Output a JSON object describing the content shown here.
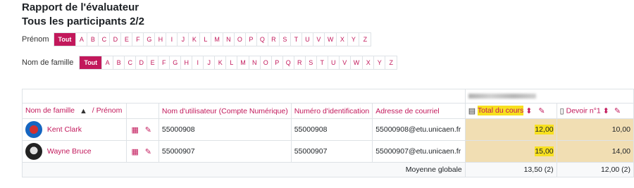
{
  "page": {
    "title": "Rapport de l'évaluateur",
    "subtitle": "Tous les participants 2/2"
  },
  "filters": {
    "firstname_label": "Prénom",
    "lastname_label": "Nom de famille",
    "all_label": "Tout",
    "letters": [
      "A",
      "B",
      "C",
      "D",
      "E",
      "F",
      "G",
      "H",
      "I",
      "J",
      "K",
      "L",
      "M",
      "N",
      "O",
      "P",
      "Q",
      "R",
      "S",
      "T",
      "U",
      "V",
      "W",
      "X",
      "Y",
      "Z"
    ]
  },
  "table": {
    "course_category": "Nom du cours",
    "headers": {
      "name_sort": "Nom de famille",
      "firstname": "/ Prénom",
      "username": "Nom d'utilisateur (Compte Numérique)",
      "idnumber": "Numéro d'identification",
      "email": "Adresse de courriel",
      "course_total": "Total du cours",
      "assign1": "Devoir n°1"
    },
    "rows": [
      {
        "name": "Kent Clark",
        "username": "55000908",
        "idnumber": "55000908",
        "email": "55000908@etu.unicaen.fr",
        "total": "12,00",
        "assign1": "10,00"
      },
      {
        "name": "Wayne Bruce",
        "username": "55000907",
        "idnumber": "55000907",
        "email": "55000907@etu.unicaen.fr",
        "total": "15,00",
        "assign1": "14,00"
      }
    ],
    "average": {
      "label": "Moyenne globale",
      "total": "13,50 (2)",
      "assign1": "12,00 (2)"
    }
  }
}
